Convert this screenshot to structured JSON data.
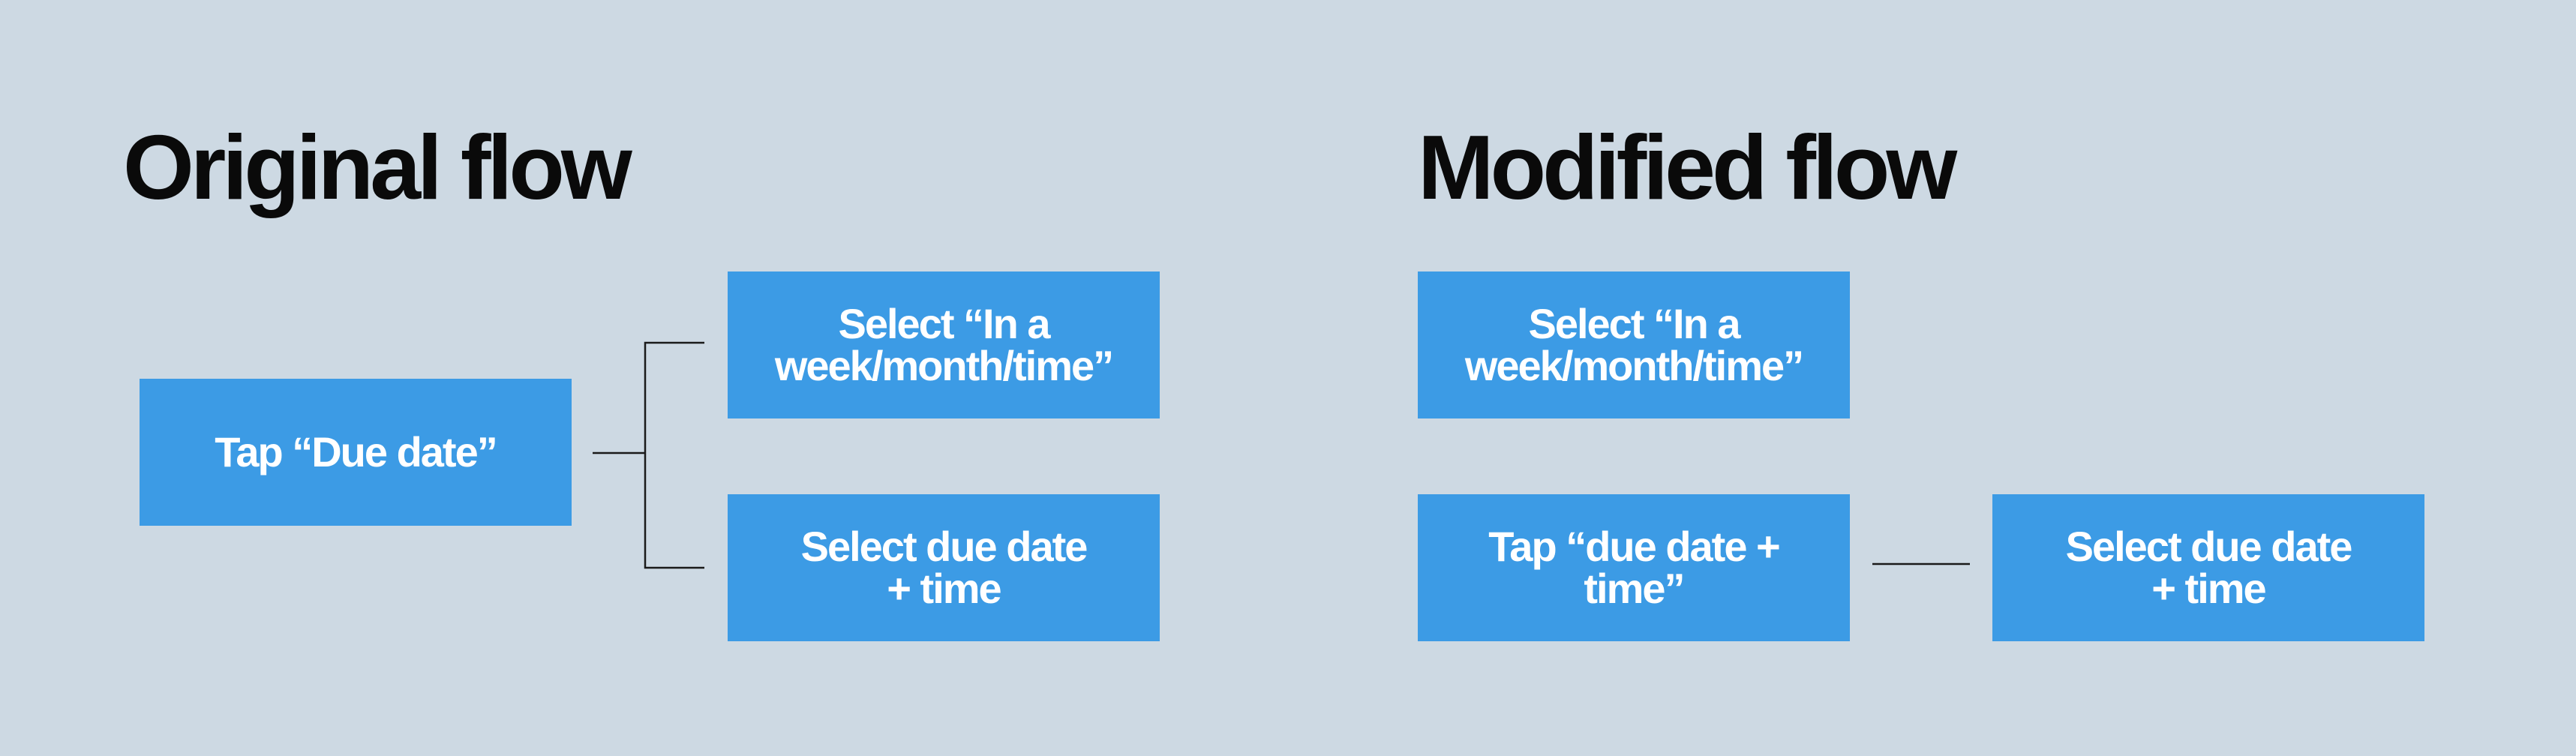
{
  "original_flow": {
    "title": "Original flow",
    "start": "Tap “Due date”",
    "option_preset": "Select “In a\nweek/month/time”",
    "option_custom": "Select due date\n+ time"
  },
  "modified_flow": {
    "title": "Modified flow",
    "option_preset": "Select “In a\nweek/month/time”",
    "option_tap": "Tap “due date +\ntime”",
    "option_custom": "Select due date\n+ time"
  },
  "colors": {
    "background": "#cdd9e3",
    "box": "#3c9be5",
    "box_text": "#ffffff",
    "title_text": "#0a0a0a",
    "connector": "#1a1a1a"
  }
}
